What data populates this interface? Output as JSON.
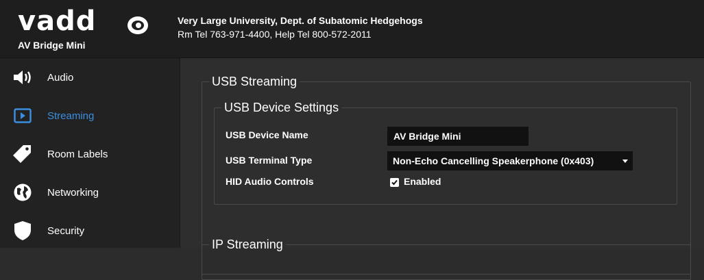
{
  "header": {
    "brand": "vadd",
    "product": "AV Bridge Mini",
    "org_line1": "Very Large University, Dept. of Subatomic Hedgehogs",
    "org_line2": "Rm Tel 763-971-4400, Help Tel 800-572-2011"
  },
  "sidebar": {
    "items": [
      {
        "label": "Audio",
        "icon": "speaker-icon",
        "active": false
      },
      {
        "label": "Streaming",
        "icon": "play-icon",
        "active": true
      },
      {
        "label": "Room Labels",
        "icon": "tag-icon",
        "active": false
      },
      {
        "label": "Networking",
        "icon": "globe-icon",
        "active": false
      },
      {
        "label": "Security",
        "icon": "shield-icon",
        "active": false
      }
    ]
  },
  "main": {
    "usb_streaming_title": "USB Streaming",
    "usb_device_settings_title": "USB Device Settings",
    "usb_device_name_label": "USB Device Name",
    "usb_device_name_value": "AV Bridge Mini",
    "usb_terminal_type_label": "USB Terminal Type",
    "usb_terminal_type_value": "Non-Echo Cancelling Speakerphone (0x403)",
    "hid_audio_controls_label": "HID Audio Controls",
    "hid_audio_controls_checked": true,
    "hid_audio_controls_option": "Enabled",
    "ip_streaming_title": "IP Streaming"
  },
  "colors": {
    "accent": "#3b8ee0",
    "background": "#2e2e2e",
    "header_bg": "#1e1e1e",
    "sidebar_bg": "#222222",
    "input_bg": "#111111"
  }
}
